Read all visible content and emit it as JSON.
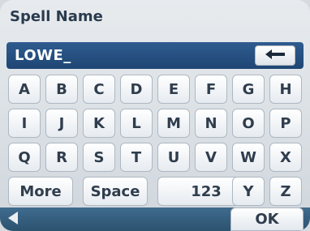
{
  "screen": {
    "title": "Spell Name"
  },
  "input": {
    "value": "LOWE_"
  },
  "keyboard": {
    "row1": [
      "A",
      "B",
      "C",
      "D",
      "E",
      "F",
      "G",
      "H"
    ],
    "row2": [
      "I",
      "J",
      "K",
      "L",
      "M",
      "N",
      "O",
      "P"
    ],
    "row3": [
      "Q",
      "R",
      "S",
      "T",
      "U",
      "V",
      "W",
      "X"
    ],
    "row4": {
      "more": "More",
      "space": "Space",
      "num": "123",
      "y": "Y",
      "z": "Z"
    }
  },
  "footer": {
    "ok": "OK"
  },
  "icons": {
    "backspace": "left-arrow",
    "back": "left-triangle"
  },
  "colors": {
    "inputbar": "#1f4674",
    "bottom": "#2c536f"
  }
}
